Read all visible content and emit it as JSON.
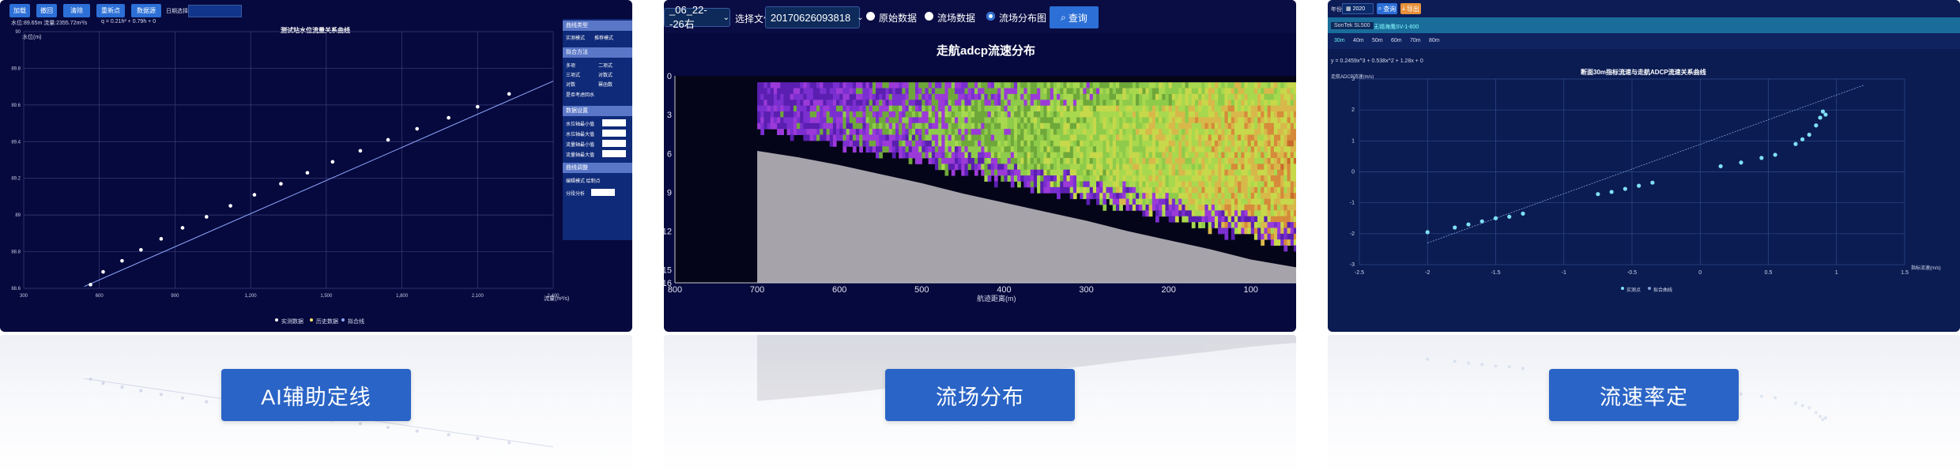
{
  "captions": [
    "AI辅助定线",
    "流场分布",
    "流速率定"
  ],
  "card1": {
    "toolbar": [
      "加载",
      "撤回",
      "清除",
      "重新点",
      "数据源"
    ],
    "toolbar_extra": "日期选择",
    "stats": "水位:89.65m 流量:2355.72m³/s",
    "formula": "q = 0.21h² + 0.79h + 0",
    "title": "测试站水位流量关系曲线",
    "ylabel": "水位(m)",
    "xlabel": "流量(m³/s)",
    "legend": [
      "实测数据",
      "历史数据",
      "拟合线"
    ],
    "panel": {
      "h1": "曲线类型",
      "h1_items": [
        "实测模式",
        "推荐模式"
      ],
      "h2": "拟合方法",
      "h2_items": [
        "多项",
        "二项式",
        "三项式",
        "对数式",
        "对数",
        "幂函数"
      ],
      "h2_check": "是否考虑回水",
      "h3": "数据设置",
      "h3_items": [
        "水位轴最小值",
        "水位轴最大值",
        "流量轴最小值",
        "流量轴最大值"
      ],
      "h4": "曲线调整",
      "h4_items": [
        "编辑模式 绘制点",
        "分段分析"
      ]
    },
    "chart_data": {
      "type": "scatter",
      "title": "测试站水位流量关系曲线",
      "xlabel": "流量(m³/s)",
      "ylabel": "水位(m)",
      "xlim": [
        300,
        2400
      ],
      "ylim": [
        88.6,
        90.0
      ],
      "x_ticks": [
        "300",
        "600",
        "900",
        "1,200",
        "1,500",
        "1,800",
        "2,100",
        "2,400"
      ],
      "y_ticks": [
        "88.6",
        "88.8",
        "89",
        "89.2",
        "89.4",
        "89.6",
        "89.8",
        "90"
      ],
      "points": [
        {
          "x": 565,
          "y": 88.62
        },
        {
          "x": 615,
          "y": 88.69
        },
        {
          "x": 690,
          "y": 88.75
        },
        {
          "x": 765,
          "y": 88.81
        },
        {
          "x": 845,
          "y": 88.87
        },
        {
          "x": 930,
          "y": 88.93
        },
        {
          "x": 1025,
          "y": 88.99
        },
        {
          "x": 1120,
          "y": 89.05
        },
        {
          "x": 1215,
          "y": 89.11
        },
        {
          "x": 1320,
          "y": 89.17
        },
        {
          "x": 1425,
          "y": 89.23
        },
        {
          "x": 1525,
          "y": 89.29
        },
        {
          "x": 1635,
          "y": 89.35
        },
        {
          "x": 1745,
          "y": 89.41
        },
        {
          "x": 1860,
          "y": 89.47
        },
        {
          "x": 1985,
          "y": 89.53
        },
        {
          "x": 2100,
          "y": 89.59
        },
        {
          "x": 2225,
          "y": 89.66
        }
      ],
      "line": [
        {
          "x": 540,
          "y": 88.61
        },
        {
          "x": 2400,
          "y": 89.73
        }
      ]
    }
  },
  "card2": {
    "date_select": "_06_22--26右",
    "file_label": "选择文件",
    "file_value": "20170626093818",
    "radios": [
      "原始数据",
      "流场数据",
      "流场分布图"
    ],
    "radio_selected": 2,
    "query": "查询",
    "title": "走航adcp流速分布",
    "xlabel": "航迹距离(m)",
    "chart_data": {
      "type": "heatmap",
      "title": "走航adcp流速分布",
      "xlabel": "航迹距离(m)",
      "xlim": [
        800,
        45
      ],
      "ylim": [
        16,
        0
      ],
      "x_ticks": [
        "800",
        "700",
        "600",
        "500",
        "400",
        "300",
        "200",
        "100"
      ],
      "y_ticks": [
        "0",
        "3",
        "6",
        "9",
        "12",
        "15",
        "16"
      ],
      "bed_depth": [
        {
          "x": 700,
          "y": 5.8
        },
        {
          "x": 650,
          "y": 6.3
        },
        {
          "x": 600,
          "y": 6.9
        },
        {
          "x": 550,
          "y": 7.6
        },
        {
          "x": 500,
          "y": 8.3
        },
        {
          "x": 450,
          "y": 9.1
        },
        {
          "x": 400,
          "y": 9.8
        },
        {
          "x": 350,
          "y": 10.5
        },
        {
          "x": 300,
          "y": 11.2
        },
        {
          "x": 250,
          "y": 12.0
        },
        {
          "x": 200,
          "y": 12.7
        },
        {
          "x": 150,
          "y": 13.4
        },
        {
          "x": 100,
          "y": 14.2
        },
        {
          "x": 45,
          "y": 14.8
        }
      ]
    }
  },
  "card3": {
    "year_label": "年份",
    "year_value": "2020",
    "btn1": "查询",
    "btn2": "导出",
    "tabs": [
      "SonTek SL500",
      "无锡海鹰SV-1-600"
    ],
    "subtabs": [
      "30m",
      "40m",
      "50m",
      "60m",
      "70m",
      "80m"
    ],
    "formula": "y = 0.2459x^3 + 0.538x^2 + 1.28x + 0",
    "title": "断面30m指标流速与走航ADCP流速关系曲线",
    "ylabel": "走航ADCP流速(m/s)",
    "xlabel": "指标流速(m/s)",
    "legend": [
      "实测点",
      "拟合曲线"
    ],
    "chart_data": {
      "type": "scatter",
      "title": "断面30m指标流速与走航ADCP流速关系曲线",
      "xlabel": "指标流速(m/s)",
      "ylabel": "走航ADCP流速(m/s)",
      "xlim": [
        -2.5,
        1.5
      ],
      "ylim": [
        -3,
        3
      ],
      "x_ticks": [
        "-2.5",
        "-2",
        "-1.5",
        "-1",
        "-0.5",
        "0",
        "0.5",
        "1",
        "1.5"
      ],
      "y_ticks": [
        "-3",
        "-2",
        "-1",
        "0",
        "1",
        "2",
        "3"
      ],
      "points": [
        {
          "x": -2.0,
          "y": -1.95
        },
        {
          "x": -1.8,
          "y": -1.8
        },
        {
          "x": -1.7,
          "y": -1.7
        },
        {
          "x": -1.6,
          "y": -1.6
        },
        {
          "x": -1.5,
          "y": -1.5
        },
        {
          "x": -1.4,
          "y": -1.45
        },
        {
          "x": -1.3,
          "y": -1.35
        },
        {
          "x": -0.75,
          "y": -0.72
        },
        {
          "x": -0.65,
          "y": -0.65
        },
        {
          "x": -0.55,
          "y": -0.55
        },
        {
          "x": -0.45,
          "y": -0.45
        },
        {
          "x": -0.35,
          "y": -0.35
        },
        {
          "x": 0.15,
          "y": 0.18
        },
        {
          "x": 0.3,
          "y": 0.3
        },
        {
          "x": 0.45,
          "y": 0.45
        },
        {
          "x": 0.55,
          "y": 0.55
        },
        {
          "x": 0.7,
          "y": 0.9
        },
        {
          "x": 0.75,
          "y": 1.05
        },
        {
          "x": 0.8,
          "y": 1.2
        },
        {
          "x": 0.85,
          "y": 1.5
        },
        {
          "x": 0.88,
          "y": 1.75
        },
        {
          "x": 0.9,
          "y": 1.95
        },
        {
          "x": 0.92,
          "y": 1.85
        }
      ],
      "line": [
        {
          "x": -2.0,
          "y": -2.3
        },
        {
          "x": 1.2,
          "y": 2.8
        }
      ]
    }
  }
}
